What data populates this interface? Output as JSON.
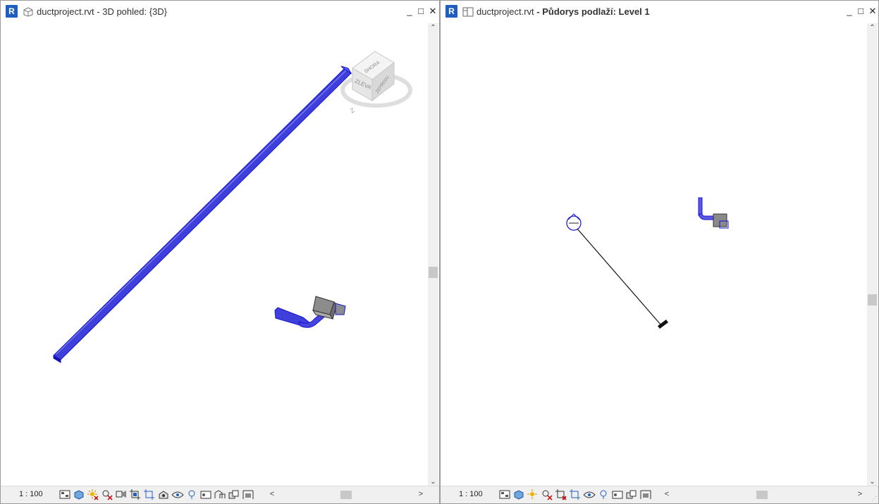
{
  "colors": {
    "duct": "#1414d2",
    "duct_fill": "#4a4ae0",
    "accent": "#1f5fbf"
  },
  "windows": [
    {
      "id": "w1",
      "logo": "R",
      "view_icon": "3d-view-icon",
      "title_file": "ductproject.rvt",
      "title_view": " - 3D pohled: {3D}",
      "viewcube": {
        "top": "SHORA",
        "front": "ZLEVA",
        "right": "ZEPŘEDU",
        "compass": "Z"
      },
      "scale": "1 : 100"
    },
    {
      "id": "w2",
      "logo": "R",
      "view_icon": "floor-plan-icon",
      "title_file": "ductproject.rvt",
      "title_view": " - Půdorys podlaží: Level 1",
      "scale": "1 : 100"
    }
  ],
  "window_controls": {
    "minimize": "_",
    "maximize": "□",
    "close": "✕"
  },
  "scroll_glyphs": {
    "up": "⌃",
    "down": "⌄",
    "left": "<",
    "right": ">"
  }
}
